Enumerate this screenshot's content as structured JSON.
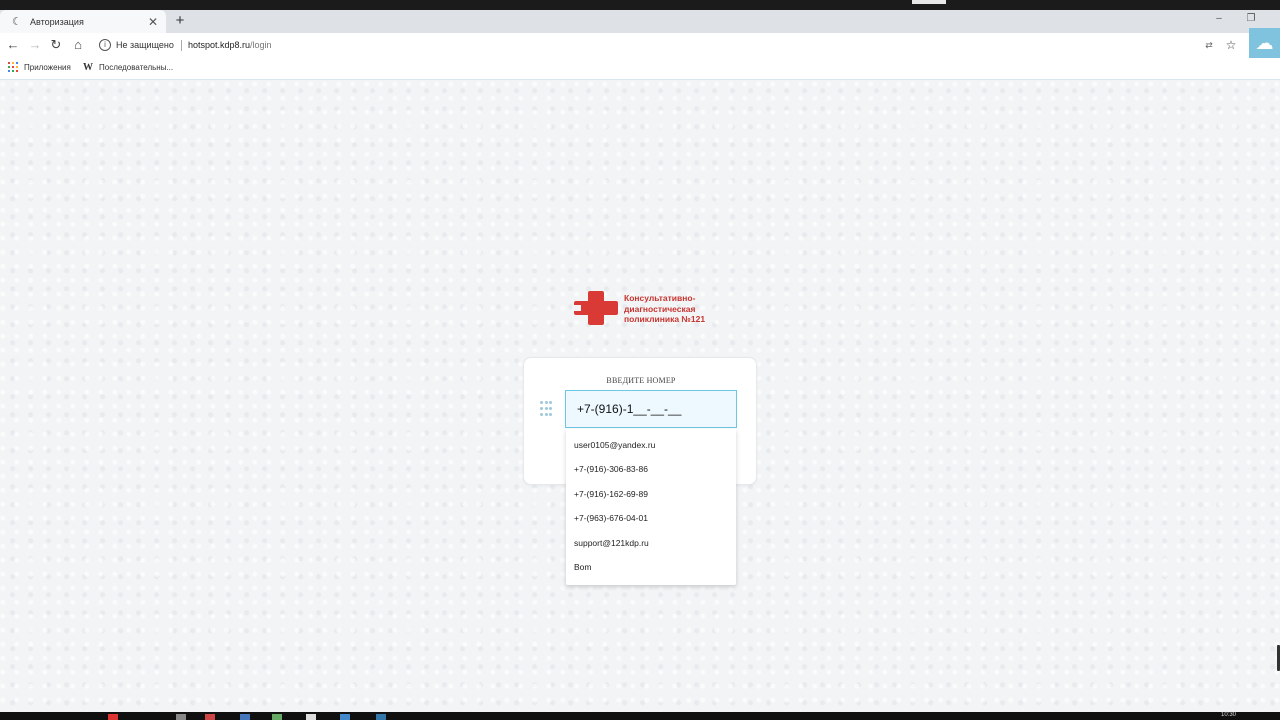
{
  "browser": {
    "tab": {
      "title": "Авторизация"
    },
    "new_tab_label": "+",
    "window_controls": {
      "minimize": "–",
      "restore": "❐"
    },
    "nav": {
      "back": "←",
      "forward": "→",
      "reload": "↻",
      "home": "⌂"
    },
    "address": {
      "security_label": "Не защищено",
      "host": "hotspot.kdp8.ru",
      "path": "/login"
    },
    "bookmarks": [
      {
        "label": "Приложения",
        "icon": "apps-grid-icon"
      },
      {
        "label": "Последовательны...",
        "icon": "wikipedia-icon"
      }
    ]
  },
  "page": {
    "logo": {
      "text_lines": [
        "Консультативно-",
        "диагностическая",
        "поликлиника №121"
      ],
      "color": "#d93a35"
    },
    "login": {
      "label": "ВВЕДИТЕ НОМЕР",
      "phone_value": "+7-(916)-1__-__-__"
    },
    "autocomplete": [
      "user0105@yandex.ru",
      "+7-(916)-306-83-86",
      "+7-(916)-162-69-89",
      "+7-(963)-676-04-01",
      "support@121kdp.ru",
      "Bom"
    ]
  },
  "taskbar": {
    "clock": "10:30"
  },
  "colors": {
    "accent": "#6cc7e3",
    "brand_red": "#d93a35",
    "input_bg": "#eef9ff"
  }
}
